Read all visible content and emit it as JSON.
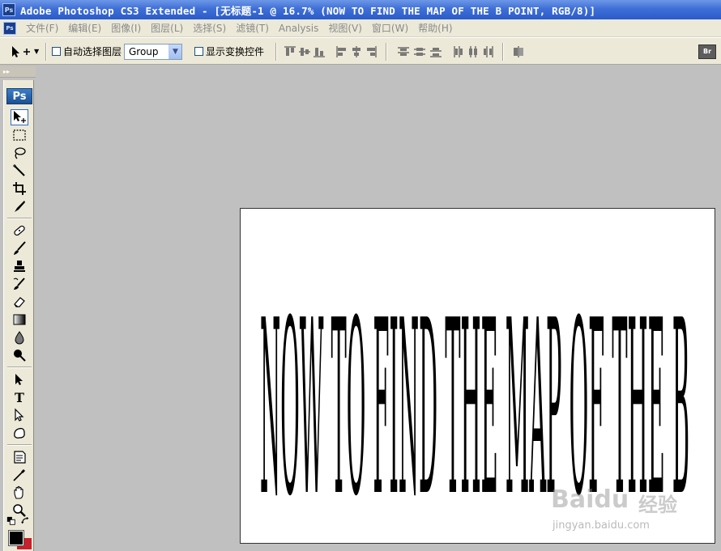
{
  "window": {
    "title": "Adobe Photoshop CS3 Extended - [无标题-1 @ 16.7% (NOW TO FIND THE MAP OF THE B POINT, RGB/8)]",
    "app_icon_text": "Ps",
    "accent_color": "#2a5bc9"
  },
  "menu": {
    "items": [
      {
        "label": "文件(F)"
      },
      {
        "label": "编辑(E)"
      },
      {
        "label": "图像(I)"
      },
      {
        "label": "图层(L)"
      },
      {
        "label": "选择(S)"
      },
      {
        "label": "滤镜(T)"
      },
      {
        "label": "Analysis"
      },
      {
        "label": "视图(V)"
      },
      {
        "label": "窗口(W)"
      },
      {
        "label": "帮助(H)"
      }
    ]
  },
  "options": {
    "auto_select_label": "自动选择图层",
    "auto_select_checked": false,
    "group_select_value": "Group",
    "show_transform_label": "显示变换控件",
    "show_transform_checked": false,
    "bridge_icon_text": "Br"
  },
  "toolbox": {
    "logo_text": "Ps",
    "type_tool_glyph": "T",
    "foreground_color": "#000000",
    "background_color": "#c8202c"
  },
  "document": {
    "headline_text": "NOW TO FIND THE MAP OF THE B",
    "zoom": "16.7%",
    "mode": "RGB/8"
  },
  "watermark": {
    "brand": "Baidu",
    "cn": "经验",
    "url": "jingyan.baidu.com"
  }
}
